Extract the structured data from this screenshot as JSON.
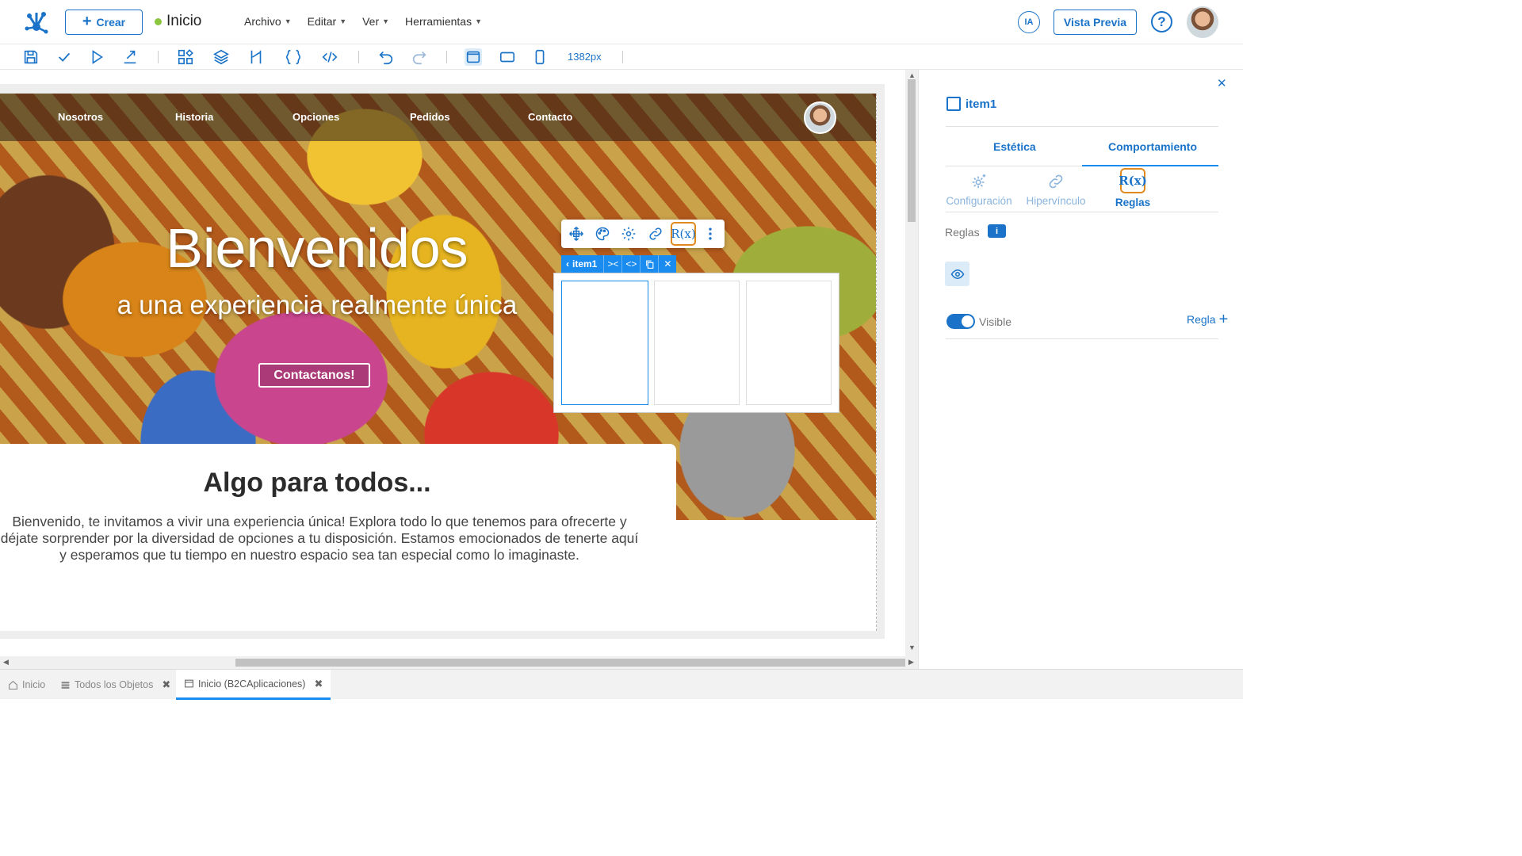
{
  "header": {
    "create_label": "Crear",
    "page_title": "Inicio",
    "menus": [
      "Archivo",
      "Editar",
      "Ver",
      "Herramientas"
    ],
    "ia_label": "IA",
    "preview_label": "Vista Previa",
    "help_label": "?"
  },
  "toolbar": {
    "width_label": "1382px",
    "icons": [
      "save-icon",
      "check-icon",
      "play-icon",
      "export-icon",
      "components-icon",
      "layers-icon",
      "flow-icon",
      "braces-icon",
      "code-icon",
      "undo-icon",
      "redo-icon",
      "desktop-icon",
      "tablet-icon",
      "mobile-icon"
    ]
  },
  "canvas": {
    "nav_links": [
      "Nosotros",
      "Historia",
      "Opciones",
      "Pedidos",
      "Contacto"
    ],
    "hero_title": "Bienvenidos",
    "hero_subtitle": "a una experiencia realmente única",
    "hero_button": "Contactanos!",
    "card_title": "Algo para todos...",
    "card_text": "Bienvenido, te invitamos a vivir una experiencia única! Explora todo lo que tenemos para ofrecerte y déjate sorprender por la diversidad de opciones a tu disposición. Estamos emocionados de tenerte aquí y esperamos que tu tiempo en nuestro espacio sea tan especial como lo imaginaste.",
    "selected_item": "item1",
    "rules_icon_label": "R(x)"
  },
  "panel": {
    "item_name": "item1",
    "tabs": [
      "Estética",
      "Comportamiento"
    ],
    "active_tab": "Comportamiento",
    "subtabs": [
      "Configuración",
      "Hipervínculo",
      "Reglas"
    ],
    "active_subtab": "Reglas",
    "rules_label": "Reglas",
    "info_label": "i",
    "visible_label": "Visible",
    "visible_on": true,
    "add_rule_label": "Regla"
  },
  "bottom_tabs": [
    {
      "label": "Inicio",
      "closable": false
    },
    {
      "label": "Todos los Objetos",
      "closable": true
    },
    {
      "label": "Inicio (B2CAplicaciones)",
      "closable": true,
      "active": true
    }
  ],
  "colors": {
    "accent": "#1a73c8",
    "selection": "#1a8cf0",
    "highlight": "#e08a1e",
    "status": "#8cc63f"
  }
}
